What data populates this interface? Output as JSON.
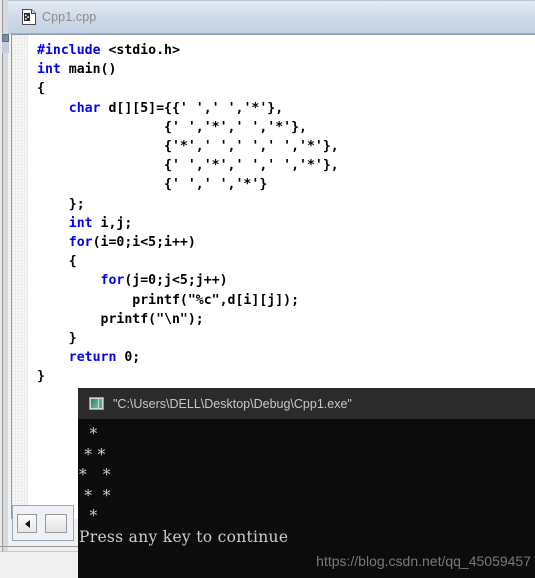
{
  "editor": {
    "tab": {
      "label": "Cpp1.cpp",
      "icon": "cpp-document-icon"
    },
    "language": "cpp",
    "code_lines": [
      {
        "indent": 0,
        "tokens": [
          {
            "t": "#include",
            "c": "pp"
          },
          {
            "t": " <stdio.h>",
            "c": "plain"
          }
        ]
      },
      {
        "indent": 0,
        "tokens": [
          {
            "t": "int",
            "c": "kw"
          },
          {
            "t": " main()",
            "c": "plain"
          }
        ]
      },
      {
        "indent": 0,
        "tokens": [
          {
            "t": "{",
            "c": "plain"
          }
        ]
      },
      {
        "indent": 4,
        "tokens": [
          {
            "t": "char",
            "c": "kw"
          },
          {
            "t": " d[][5]={{' ',' ','*'},",
            "c": "plain"
          }
        ]
      },
      {
        "indent": 4,
        "tokens": [
          {
            "t": "            {' ','*',' ','*'},",
            "c": "plain"
          }
        ]
      },
      {
        "indent": 4,
        "tokens": [
          {
            "t": "            {'*',' ',' ',' ','*'},",
            "c": "plain"
          }
        ]
      },
      {
        "indent": 4,
        "tokens": [
          {
            "t": "            {' ','*',' ',' ','*'},",
            "c": "plain"
          }
        ]
      },
      {
        "indent": 4,
        "tokens": [
          {
            "t": "            {' ',' ','*'}",
            "c": "plain"
          }
        ]
      },
      {
        "indent": 4,
        "tokens": [
          {
            "t": "};",
            "c": "plain"
          }
        ]
      },
      {
        "indent": 4,
        "tokens": [
          {
            "t": "int",
            "c": "kw"
          },
          {
            "t": " i,j;",
            "c": "plain"
          }
        ]
      },
      {
        "indent": 4,
        "tokens": [
          {
            "t": "for",
            "c": "kw"
          },
          {
            "t": "(i=0;i<5;i++)",
            "c": "plain"
          }
        ]
      },
      {
        "indent": 4,
        "tokens": [
          {
            "t": "{",
            "c": "plain"
          }
        ]
      },
      {
        "indent": 8,
        "tokens": [
          {
            "t": "for",
            "c": "kw"
          },
          {
            "t": "(j=0;j<5;j++)",
            "c": "plain"
          }
        ]
      },
      {
        "indent": 12,
        "tokens": [
          {
            "t": "printf(\"%c\",d[i][j]);",
            "c": "plain"
          }
        ]
      },
      {
        "indent": 8,
        "tokens": [
          {
            "t": "printf(\"\\n\");",
            "c": "plain"
          }
        ]
      },
      {
        "indent": 4,
        "tokens": [
          {
            "t": "}",
            "c": "plain"
          }
        ]
      },
      {
        "indent": 4,
        "tokens": [
          {
            "t": "return",
            "c": "kw"
          },
          {
            "t": " 0;",
            "c": "plain"
          }
        ]
      },
      {
        "indent": 0,
        "tokens": [
          {
            "t": "}",
            "c": "plain"
          }
        ]
      }
    ],
    "code_text": "#include <stdio.h>\nint main()\n{\n    char d[][5]={{' ',' ','*'},\n                {' ','*',' ','*'},\n                {'*',' ',' ',' ','*'},\n                {' ','*',' ',' ','*'},\n                {' ',' ','*'}\n    };\n    int i,j;\n    for(i=0;i<5;i++)\n    {\n        for(j=0;j<5;j++)\n            printf(\"%c\",d[i][j]);\n        printf(\"\\n\");\n    }\n    return 0;\n}",
    "scrollbars": {
      "horizontal_left_arrow": "◀",
      "vertical_present": true
    }
  },
  "console": {
    "title": "\"C:\\Users\\DELL\\Desktop\\Debug\\Cpp1.exe\"",
    "icon": "console-window-icon",
    "output_lines": [
      "  *",
      " * *",
      "*   *",
      " *  *",
      "  *",
      "Press any key to continue"
    ],
    "output_text": "  *\n * *\n*   *\n *  *\n  *\nPress any key to continue",
    "background_color": "#0c0c0c",
    "titlebar_color": "#2b2b2b",
    "text_color": "#cccccc"
  },
  "watermark": {
    "text": "https://blog.csdn.net/qq_45059457"
  },
  "colors": {
    "keyword_blue": "#0000ff",
    "code_black": "#000000",
    "tab_strip": "#cdd9e8",
    "tab_label": "#8a8a8a"
  }
}
